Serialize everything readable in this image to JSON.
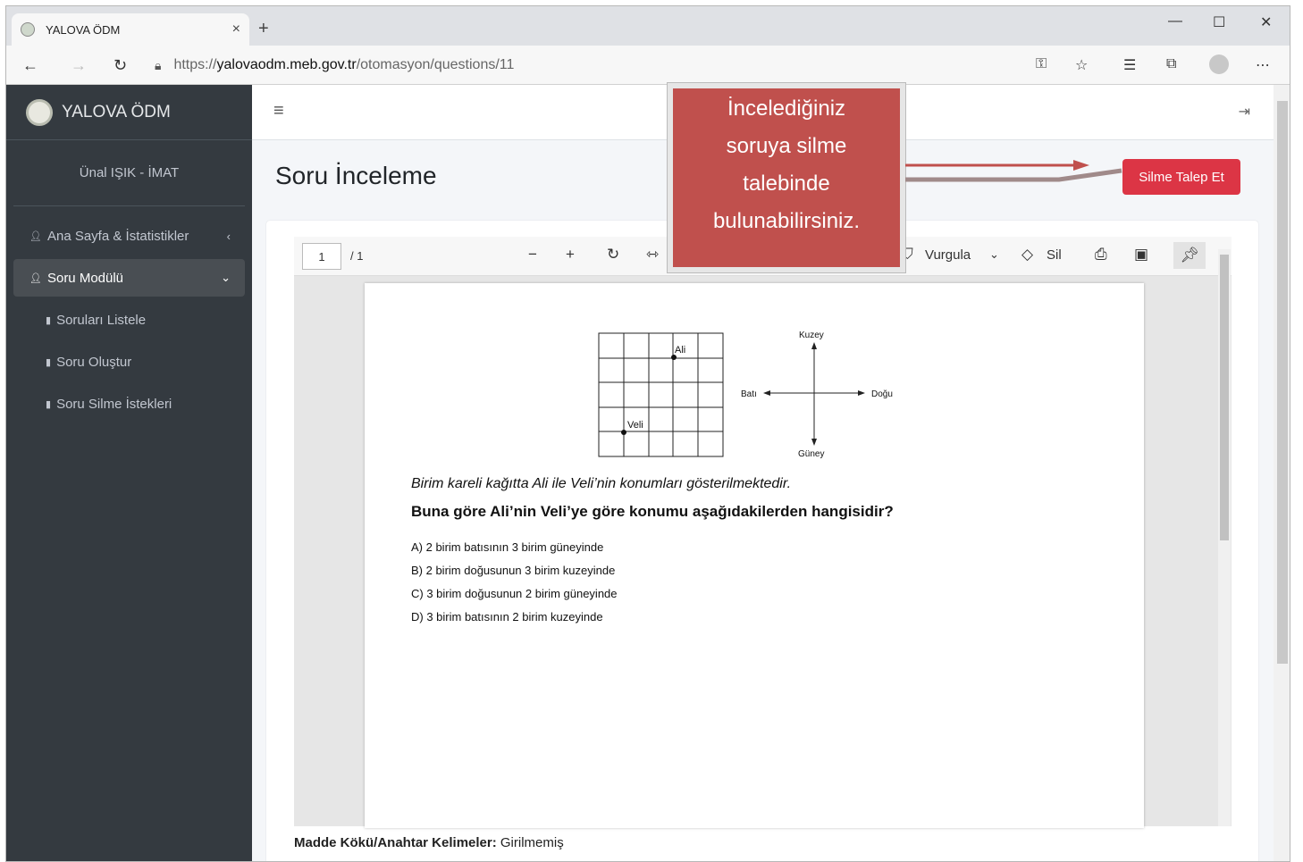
{
  "browser": {
    "tab_title": "YALOVA ÖDM",
    "tab_close": "×",
    "new_tab": "+",
    "url_protocol": "https://",
    "url_host": "yalovaodm.meb.gov.tr",
    "url_path": "/otomasyon/questions/11",
    "minimize": "—",
    "maximize": "☐",
    "close": "✕"
  },
  "sidebar": {
    "brand": "YALOVA ÖDM",
    "user": "Ünal IŞIK - İMAT",
    "items": [
      {
        "label": "Ana Sayfa & İstatistikler"
      },
      {
        "label": "Soru Modülü"
      },
      {
        "label": "Soruları Listele"
      },
      {
        "label": "Soru Oluştur"
      },
      {
        "label": "Soru Silme İstekleri"
      }
    ]
  },
  "main": {
    "page_title": "Soru İnceleme",
    "delete_button": "Silme Talep Et",
    "callout": [
      "İncelediğiniz",
      "soruya silme",
      "talebinde",
      "bulunabilirsiniz."
    ]
  },
  "pdf_toolbar": {
    "page_current": "1",
    "page_total": "/ 1",
    "highlight_label": "Vurgula",
    "erase_label": "Sil"
  },
  "question": {
    "grid_label_ali": "Ali",
    "grid_label_veli": "Veli",
    "compass_north": "Kuzey",
    "compass_south": "Güney",
    "compass_east": "Doğu",
    "compass_west": "Batı",
    "stem": "Birim kareli kağıtta Ali ile Veli’nin konumları gösterilmektedir.",
    "prompt": "Buna göre Ali’nin Veli’ye göre konumu aşağıdakilerden hangisidir?",
    "options": [
      "A) 2 birim batısının 3 birim güneyinde",
      "B) 2 birim doğusunun 3 birim kuzeyinde",
      "C) 3 birim doğusunun 2 birim güneyinde",
      "D) 3 birim batısının 2 birim kuzeyinde"
    ]
  },
  "meta": {
    "keywords_label": "Madde Kökü/Anahtar Kelimeler:",
    "keywords_value": "Girilmemiş"
  },
  "colors": {
    "sidebar_bg": "#343a40",
    "danger": "#dc3545",
    "callout_bg": "#c0504d"
  }
}
